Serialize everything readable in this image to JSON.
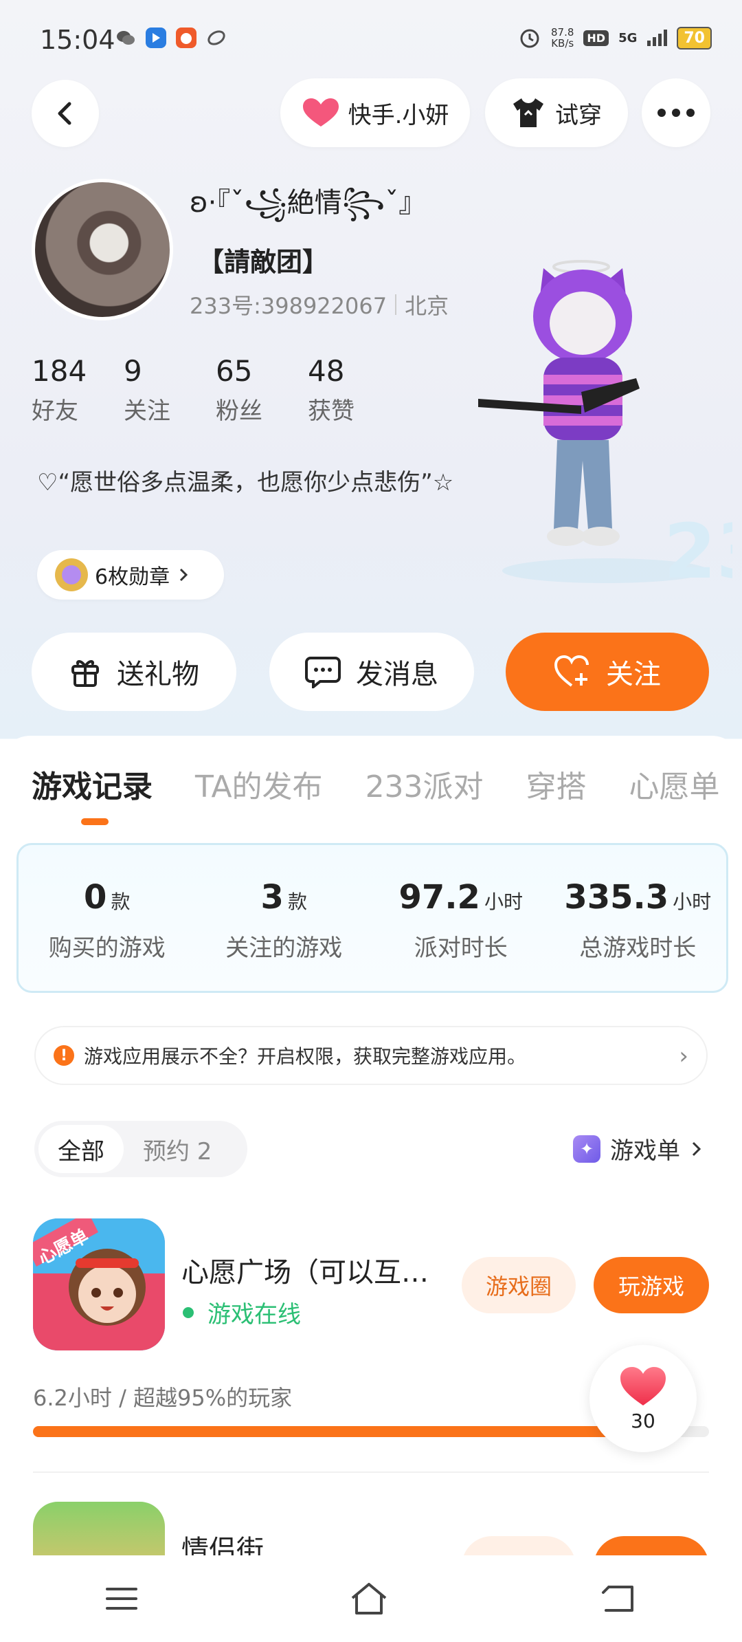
{
  "status_bar": {
    "time": "15:04",
    "net_speed": "87.8",
    "net_unit": "KB/s",
    "hd": "HD",
    "network": "5G",
    "battery": "70"
  },
  "header": {
    "kuaishou_label": "快手.小妍",
    "tryon_label": "试穿"
  },
  "profile": {
    "nickname": "ʚ·『ˇ꧁絶情꧂ˇ』",
    "clan": "【請敵团】",
    "uid": "233号:398922067",
    "location": "北京",
    "stats": [
      {
        "value": "184",
        "label": "好友"
      },
      {
        "value": "9",
        "label": "关注"
      },
      {
        "value": "65",
        "label": "粉丝"
      },
      {
        "value": "48",
        "label": "获赞"
      }
    ],
    "bio": "♡“愿世俗多点温柔，也愿你少点悲伤”☆",
    "medals": "6枚勋章"
  },
  "actions": {
    "gift": "送礼物",
    "message": "发消息",
    "follow": "关注"
  },
  "tabs": [
    "游戏记录",
    "TA的发布",
    "233派对",
    "穿搭",
    "心愿单"
  ],
  "summary": [
    {
      "value": "0",
      "unit": "款",
      "label": "购买的游戏"
    },
    {
      "value": "3",
      "unit": "款",
      "label": "关注的游戏"
    },
    {
      "value": "97.2",
      "unit": "小时",
      "label": "派对时长"
    },
    {
      "value": "335.3",
      "unit": "小时",
      "label": "总游戏时长"
    }
  ],
  "notice": "游戏应用展示不全？开启权限，获取完整游戏应用。",
  "filters": {
    "all": "全部",
    "reserve": "预约 2"
  },
  "game_list_link": "游戏单",
  "games": [
    {
      "title": "心愿广场（可以互…",
      "icon_badge": "心愿单",
      "status": "游戏在线",
      "circle_btn": "游戏圈",
      "play_btn": "玩游戏",
      "play_stats": "6.2小时 / 超越95%的玩家",
      "progress": 0.95
    },
    {
      "title": "情侣街"
    }
  ],
  "like": {
    "count": "30"
  },
  "colors": {
    "accent": "#fb7319",
    "online": "#2bbf74"
  }
}
